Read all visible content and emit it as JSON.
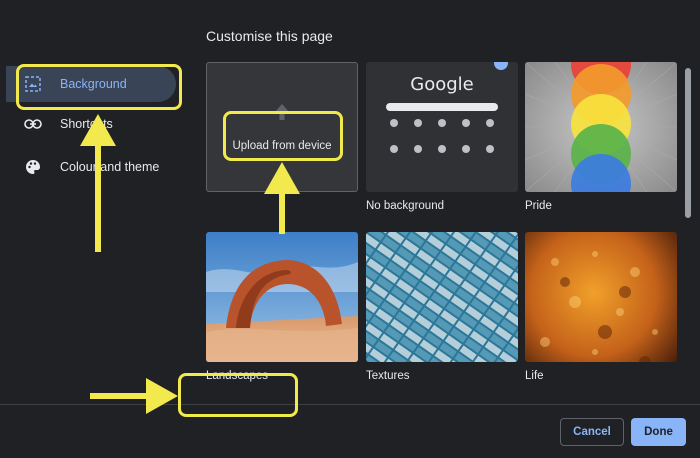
{
  "dialog": {
    "title": "Customise this page"
  },
  "sidebar": {
    "items": [
      {
        "label": "Background",
        "icon": "background-image-icon",
        "active": true
      },
      {
        "label": "Shortcuts",
        "icon": "link-icon",
        "active": false
      },
      {
        "label": "Colour and theme",
        "icon": "palette-icon",
        "active": false
      }
    ]
  },
  "grid": {
    "upload_label": "Upload from device",
    "tiles": [
      {
        "caption": ""
      },
      {
        "caption": "No background",
        "logo_text": "Google"
      },
      {
        "caption": "Pride"
      },
      {
        "caption": "Landscapes"
      },
      {
        "caption": "Textures"
      },
      {
        "caption": "Life"
      }
    ]
  },
  "footer": {
    "cancel_label": "Cancel",
    "done_label": "Done"
  },
  "colors": {
    "accent": "#8ab4f8",
    "annotation_yellow": "#f2e94e",
    "background": "#202124"
  }
}
